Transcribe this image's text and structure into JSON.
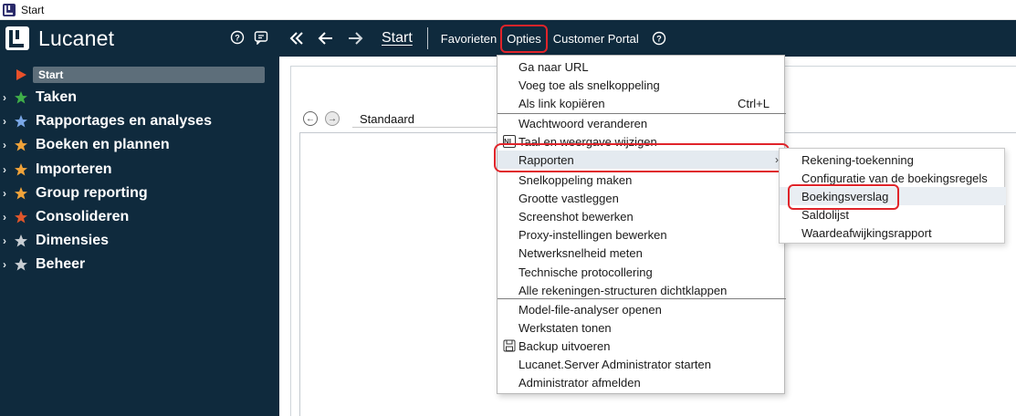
{
  "window": {
    "title": "Start"
  },
  "brand": {
    "name": "Lucanet"
  },
  "sidebar": {
    "start_label": "Start",
    "items": [
      {
        "label": "Taken",
        "star_color": "#3fae49"
      },
      {
        "label": "Rapportages en analyses",
        "star_color": "#7aa7e6"
      },
      {
        "label": "Boeken en plannen",
        "star_color": "#f0a33a"
      },
      {
        "label": "Importeren",
        "star_color": "#f0a33a"
      },
      {
        "label": "Group reporting",
        "star_color": "#f0a33a"
      },
      {
        "label": "Consolideren",
        "star_color": "#e0562b"
      },
      {
        "label": "Dimensies",
        "star_color": "#c8ced3"
      },
      {
        "label": "Beheer",
        "star_color": "#c8ced3"
      }
    ]
  },
  "toolbar": {
    "start": "Start",
    "favorieten": "Favorieten",
    "opties": "Opties",
    "customer_portal": "Customer Portal"
  },
  "main": {
    "tab_label": "Standaard"
  },
  "menu": {
    "items": [
      {
        "label": "Ga naar URL"
      },
      {
        "label": "Voeg toe als snelkoppeling"
      },
      {
        "label": "Als link kopiëren",
        "shortcut": "Ctrl+L"
      },
      {
        "label": "Wachtwoord veranderen"
      },
      {
        "label": "Taal en weergave wijzigen",
        "icon": "NL"
      },
      {
        "label": "Rapporten",
        "submenu": true
      },
      {
        "label": "Snelkoppeling maken"
      },
      {
        "label": "Grootte vastleggen"
      },
      {
        "label": "Screenshot bewerken"
      },
      {
        "label": "Proxy-instellingen bewerken"
      },
      {
        "label": "Netwerksnelheid meten"
      },
      {
        "label": "Technische protocollering"
      },
      {
        "label": "Alle rekeningen-structuren dichtklappen"
      },
      {
        "label": "Model-file-analyser openen"
      },
      {
        "label": "Werkstaten tonen"
      },
      {
        "label": "Backup uitvoeren"
      },
      {
        "label": "Lucanet.Server Administrator starten"
      },
      {
        "label": "Administrator afmelden"
      }
    ]
  },
  "submenu": {
    "items": [
      {
        "label": "Rekening-toekenning"
      },
      {
        "label": "Configuratie van de boekingsregels"
      },
      {
        "label": "Boekingsverslag"
      },
      {
        "label": "Saldolijst"
      },
      {
        "label": "Waardeafwijkingsrapport"
      }
    ]
  },
  "colors": {
    "header_bg": "#0f2a3d",
    "highlight": "#e0242a"
  }
}
